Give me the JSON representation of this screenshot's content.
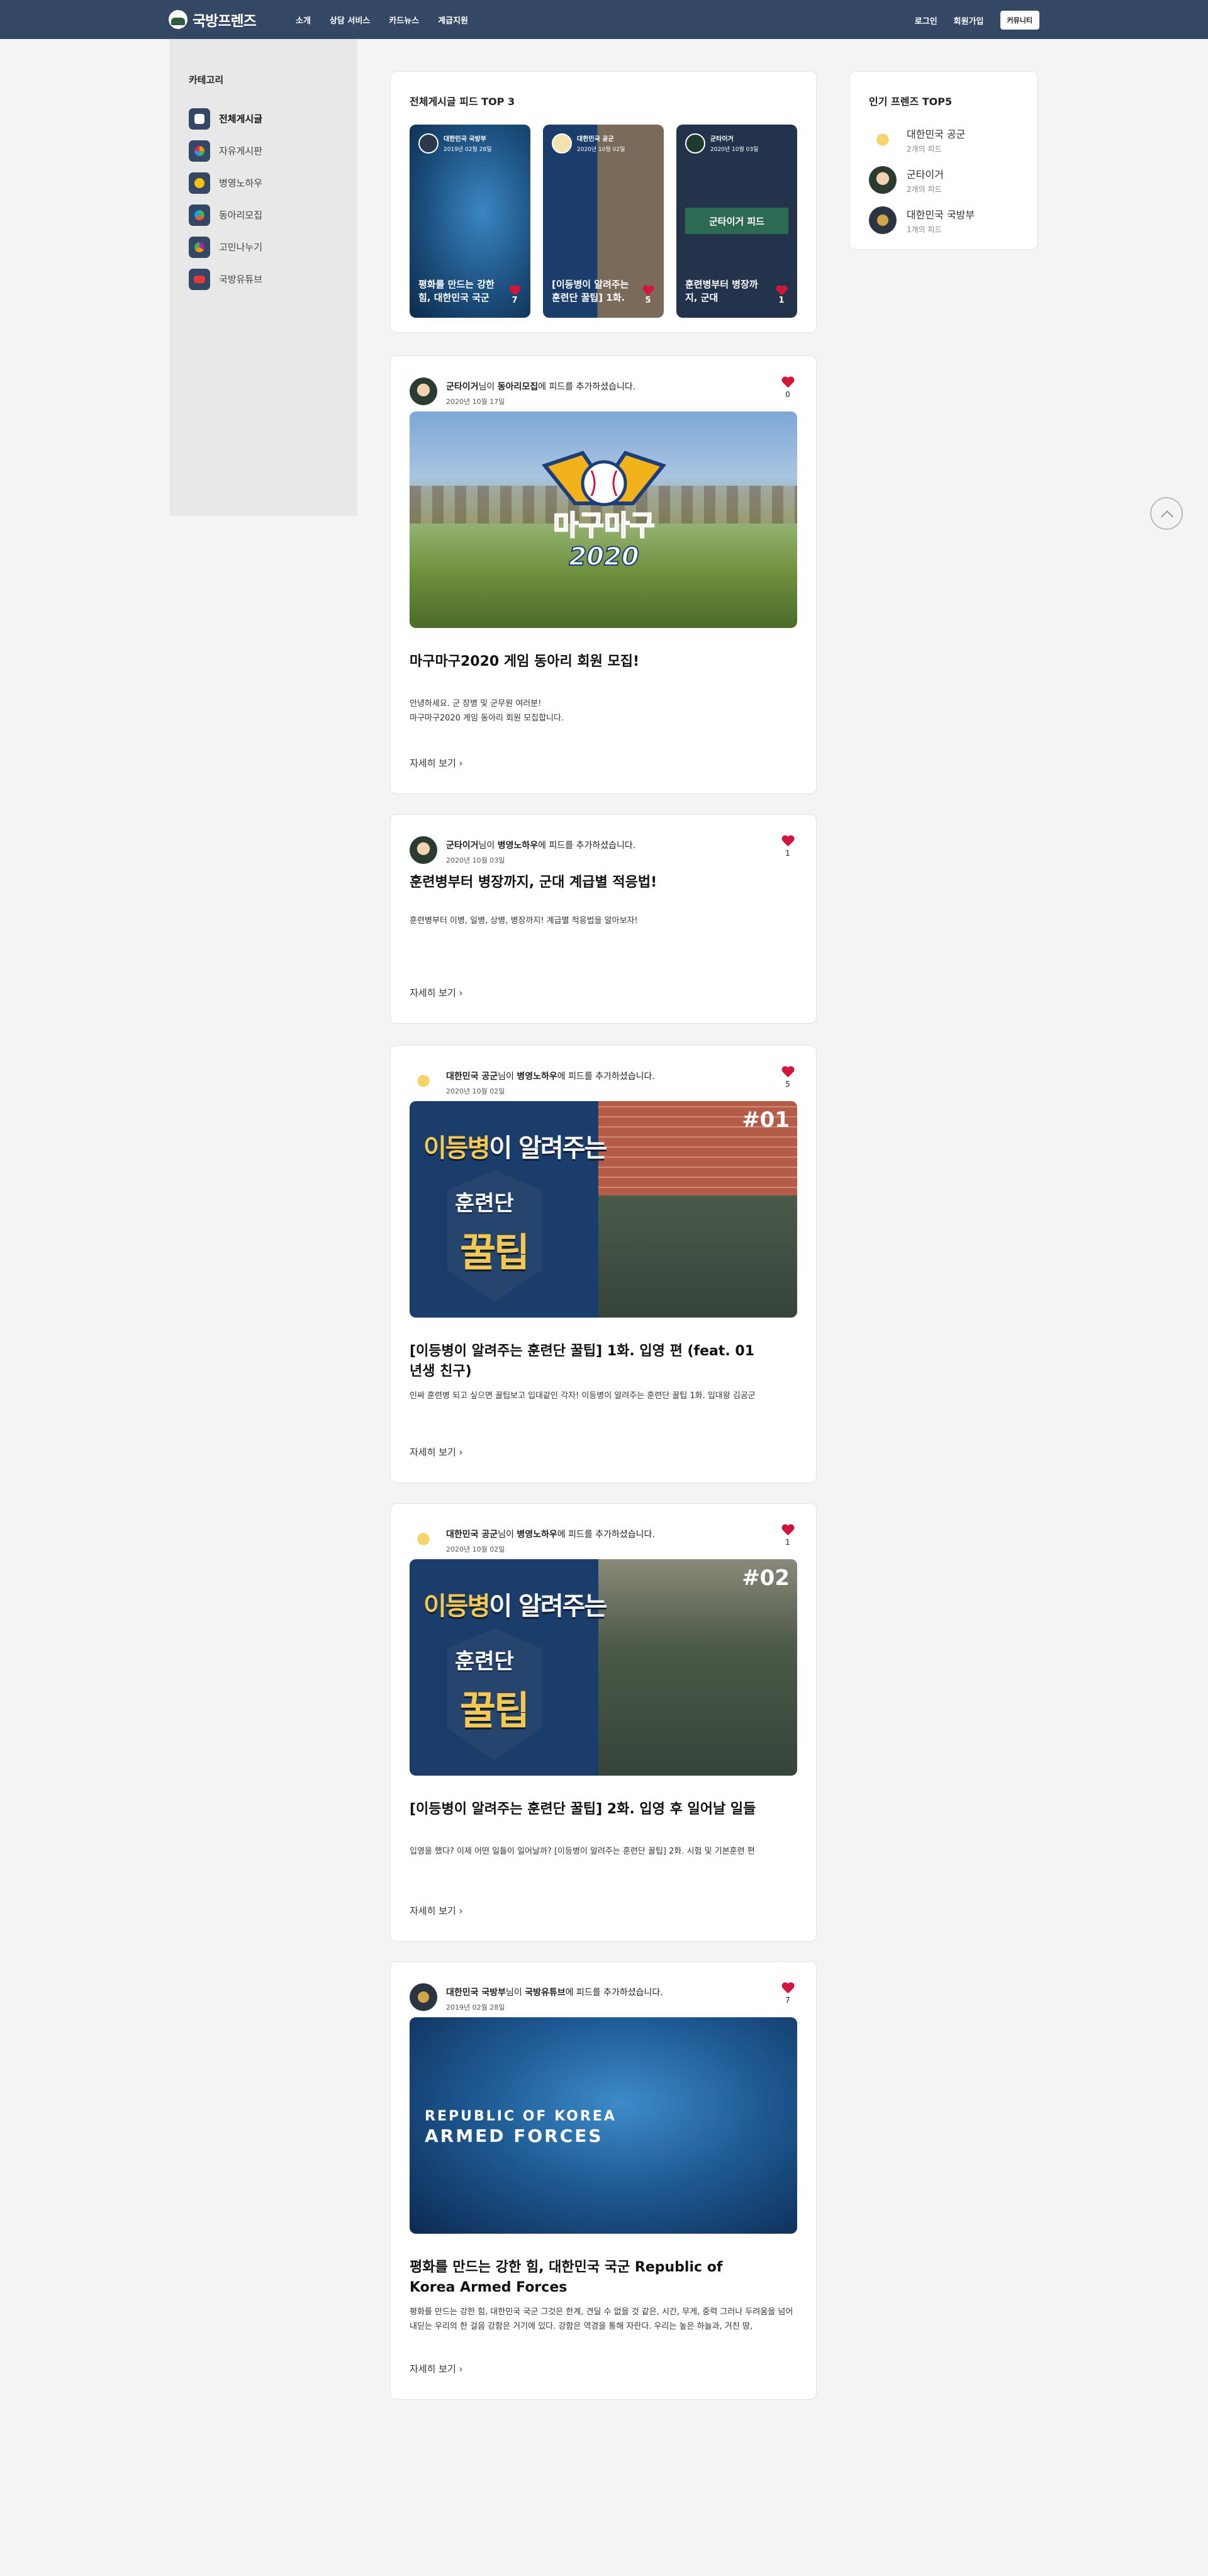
{
  "header": {
    "brand": "국방프렌즈",
    "nav": [
      "소개",
      "상담 서비스",
      "카드뉴스",
      "계급지원"
    ],
    "login": "로그인",
    "signup": "회원가입",
    "cta": "커뮤니티"
  },
  "sidebar": {
    "title": "카테고리",
    "items": [
      {
        "label": "전체게시글",
        "icon": "chat-icon",
        "color": "#ffffff"
      },
      {
        "label": "자유게시판",
        "icon": "free-board-icon",
        "color": "#ff9800"
      },
      {
        "label": "병영노하우",
        "icon": "lightbulb-icon",
        "color": "#ffc107"
      },
      {
        "label": "동아리모집",
        "icon": "club-icon",
        "color": "#4caf50"
      },
      {
        "label": "고민나누기",
        "icon": "share-icon",
        "color": "#9c27b0"
      },
      {
        "label": "국방유튜브",
        "icon": "youtube-icon",
        "color": "#e53935"
      }
    ]
  },
  "top3": {
    "title": "전체게시글 피드 TOP 3",
    "items": [
      {
        "author": "대한민국 국방부",
        "date": "2019년 02월 28일",
        "title": "평화를 만드는 강한 힘, 대한민국 국군",
        "likes": "7"
      },
      {
        "author": "대한민국 공군",
        "date": "2020년 10월 02일",
        "title": "[이등병이 알려주는 훈련단 꿀팁] 1화.",
        "likes": "5"
      },
      {
        "author": "군타이거",
        "date": "2020년 10월 03일",
        "title": "훈련병부터 병장까지, 군대",
        "badge": "군타이거 피드",
        "likes": "1"
      }
    ]
  },
  "popular": {
    "title": "인기 프렌즈 TOP5",
    "items": [
      {
        "name": "대한민국 공군",
        "count": "2개의 피드"
      },
      {
        "name": "군타이거",
        "count": "2개의 피드"
      },
      {
        "name": "대한민국 국방부",
        "count": "1개의 피드"
      }
    ]
  },
  "feeds": [
    {
      "author": "군타이거",
      "suffix": "님이 ",
      "board": "동아리모집",
      "tail": "에 피드를 추가하셨습니다.",
      "date": "2020년 10월 17일",
      "likes": "0",
      "image_text": "마구마구 2020",
      "title": "마구마구2020 게임 동아리 회원 모집!",
      "body": [
        "안녕하세요. 군 장병 및 군무원 여러분!",
        "마구마구2020 게임 동아리 회원 모집합니다."
      ],
      "more": "자세히 보기"
    },
    {
      "author": "군타이거",
      "suffix": "님이 ",
      "board": "병영노하우",
      "tail": "에 피드를 추가하셨습니다.",
      "date": "2020년 10월 03일",
      "likes": "1",
      "title": "훈련병부터 병장까지, 군대 계급별 적응법!",
      "body": [
        "훈련병부터 이병, 일병, 상병, 병장까지! 계급별 적응법을 알아보자!"
      ],
      "more": "자세히 보기"
    },
    {
      "author": "대한민국 공군",
      "suffix": "님이 ",
      "board": "병영노하우",
      "tail": "에 피드를 추가하셨습니다.",
      "date": "2020년 10월 02일",
      "likes": "5",
      "image_text": {
        "line1a": "이등병",
        "line1b": "이 알려주는",
        "line2": "훈련단",
        "line3": "꿀팁",
        "num": "#01"
      },
      "title": "[이등병이 알려주는 훈련단 꿀팁] 1화. 입영 편 (feat. 01년생 친구)",
      "body": [
        "인싸 훈련병 되고 싶으면 꿀팁보고 입대같인 각자! 이등병이 알려주는 훈련단 꿀팁 1화. 입대왕 김공군"
      ],
      "more": "자세히 보기"
    },
    {
      "author": "대한민국 공군",
      "suffix": "님이 ",
      "board": "병영노하우",
      "tail": "에 피드를 추가하셨습니다.",
      "date": "2020년 10월 02일",
      "likes": "1",
      "image_text": {
        "line1a": "이등병",
        "line1b": "이 알려주는",
        "line2": "훈련단",
        "line3": "꿀팁",
        "num": "#02"
      },
      "title": "[이등병이 알려주는 훈련단 꿀팁] 2화. 입영 후 일어날 일들",
      "body": [
        "입영을 했다? 이제 어떤 일들이 일어날까? [이등병이 알려주는 훈련단 꿀팁] 2화. 시험 및 기본훈련 편"
      ],
      "more": "자세히 보기"
    },
    {
      "author": "대한민국 국방부",
      "suffix": "님이 ",
      "board": "국방유튜브",
      "tail": "에 피드를 추가하셨습니다.",
      "date": "2019년 02월 28일",
      "likes": "7",
      "image_text": {
        "a": "REPUBLIC OF KOREA",
        "b": "ARMED FORCES"
      },
      "title": "평화를 만드는 강한 힘, 대한민국 국군 Republic of Korea Armed Forces",
      "body": [
        "평화를 만드는 강한 힘, 대한민국 국군 그것은 한계, 견딜 수 없을 것 같은, 시간, 무게, 중력 그러나 두려움을 넘어 내딛는 우리의 한 걸음 강함은 거기에 있다. 강함은 역경을 통해 자란다. 우리는 높은 하늘과, 거친 땅,"
      ],
      "more": "자세히 보기"
    }
  ]
}
